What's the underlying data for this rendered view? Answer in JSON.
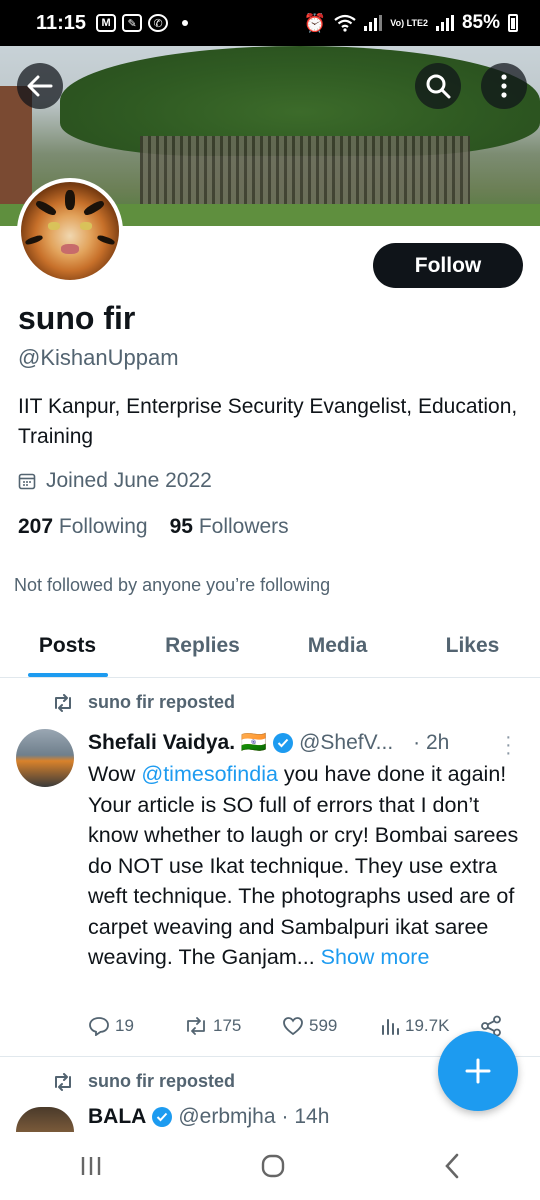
{
  "status_bar": {
    "time": "11:15",
    "battery": "85%",
    "network_label": "Vo) LTE2"
  },
  "header": {
    "back_icon": "arrow-left-icon",
    "search_icon": "search-icon",
    "more_icon": "more-vertical-icon"
  },
  "profile": {
    "name": "suno fir",
    "handle": "@KishanUppam",
    "bio": "IIT Kanpur, Enterprise Security Evangelist, Education, Training",
    "joined": "Joined June 2022",
    "following_count": "207",
    "following_label": "Following",
    "followers_count": "95",
    "followers_label": "Followers",
    "not_followed_text": "Not followed by anyone you’re following",
    "follow_button": "Follow"
  },
  "tabs": [
    {
      "label": "Posts",
      "active": true
    },
    {
      "label": "Replies",
      "active": false
    },
    {
      "label": "Media",
      "active": false
    },
    {
      "label": "Likes",
      "active": false
    }
  ],
  "tweets": [
    {
      "repost_label": "suno fir reposted",
      "author": "Shefali Vaidya. 🇮🇳",
      "handle": "@ShefV...",
      "time": "· 2h",
      "text_before_mention": "Wow ",
      "mention": "@timesofindia",
      "text_after_mention": " you have done it again! Your article is SO full of errors that I don’t know whether to laugh or cry! Bombai sarees do NOT use Ikat technique. They use extra weft technique. The photographs used are of carpet weaving and Sambalpuri ikat saree weaving. The Ganjam...",
      "show_more": "Show more",
      "replies": "19",
      "reposts": "175",
      "likes": "599",
      "views": "19.7K"
    },
    {
      "repost_label": "suno fir reposted",
      "author": "BALA",
      "handle": "@erbmjha",
      "time": "· 14h"
    }
  ],
  "colors": {
    "accent": "#1d9bf0",
    "text": "#0f1419",
    "secondary": "#536471"
  }
}
